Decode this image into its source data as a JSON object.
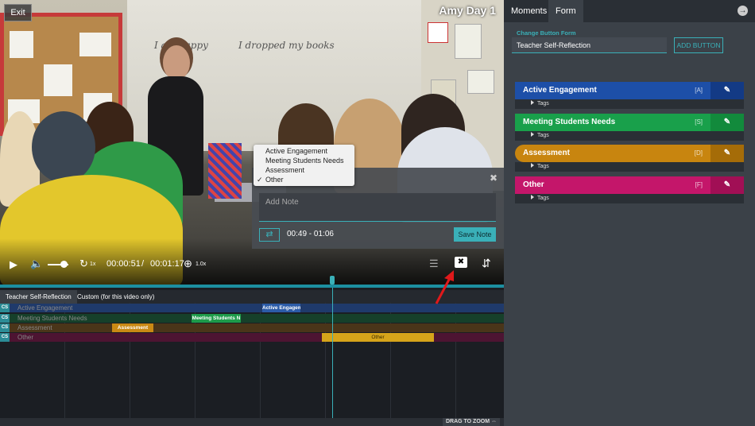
{
  "video": {
    "exit_label": "Exit",
    "title": "Amy Day 1",
    "whiteboard_text_1": "I am happy",
    "whiteboard_text_2": "I dropped my books"
  },
  "note": {
    "menu_items": [
      {
        "label": "Active Engagement",
        "checked": false
      },
      {
        "label": "Meeting Students Needs",
        "checked": false
      },
      {
        "label": "Assessment",
        "checked": false
      },
      {
        "label": "Other",
        "checked": true
      }
    ],
    "check_glyph": "✓",
    "close_glyph": "✖",
    "placeholder": "Add Note",
    "time_range": "00:49 - 01:06",
    "save_label": "Save Note"
  },
  "controls": {
    "current_time": "00:00:51",
    "separator": "/",
    "duration": "00:01:17",
    "speed": "1x",
    "zoom": "1.0x",
    "progress": 0.66
  },
  "timeline": {
    "tabs": [
      "Teacher Self-Reflection",
      "Custom (for this video only)"
    ],
    "badge": "CS",
    "rows": [
      {
        "label": "Active Engagement",
        "color": "#1f3a6b",
        "seg_color": "#2c5ca8",
        "segments": [
          {
            "label": "Active Engagem"
          }
        ]
      },
      {
        "label": "Meeting Students Needs",
        "color": "#16402a",
        "seg_color": "#1d9b4a",
        "segments": [
          {
            "label": "Meeting Students N"
          }
        ]
      },
      {
        "label": "Assessment",
        "color": "#4a3519",
        "seg_color": "#c98914",
        "segments": [
          {
            "label": "Assessment"
          }
        ]
      },
      {
        "label": "Other",
        "color": "#4d1432",
        "seg_color": "#d6a41a",
        "segments": [
          {
            "label": "Other"
          }
        ]
      }
    ],
    "drag_zoom_label": "DRAG TO ZOOM ⇔"
  },
  "panel": {
    "tabs": [
      "Moments",
      "Form"
    ],
    "active_tab": "Form",
    "change_form_label": "Change Button Form",
    "form_value": "Teacher Self-Reflection",
    "add_button_label": "ADD BUTTON",
    "categories": [
      {
        "label": "Active Engagement",
        "key": "[A]",
        "color": "#1d4fa8",
        "edit_color": "#133a85",
        "tags": "Tags"
      },
      {
        "label": "Meeting Students Needs",
        "key": "[S]",
        "color": "#19a04b",
        "edit_color": "#128a3c",
        "tags": "Tags"
      },
      {
        "label": "Assessment",
        "key": "[D]",
        "color": "#c8850f",
        "edit_color": "#a56c08",
        "tags": "Tags"
      },
      {
        "label": "Other",
        "key": "[F]",
        "color": "#c4166a",
        "edit_color": "#a10f55",
        "tags": "Tags"
      }
    ]
  },
  "colors": {
    "accent": "#3ab0b8",
    "annotation": "#e0191b"
  }
}
